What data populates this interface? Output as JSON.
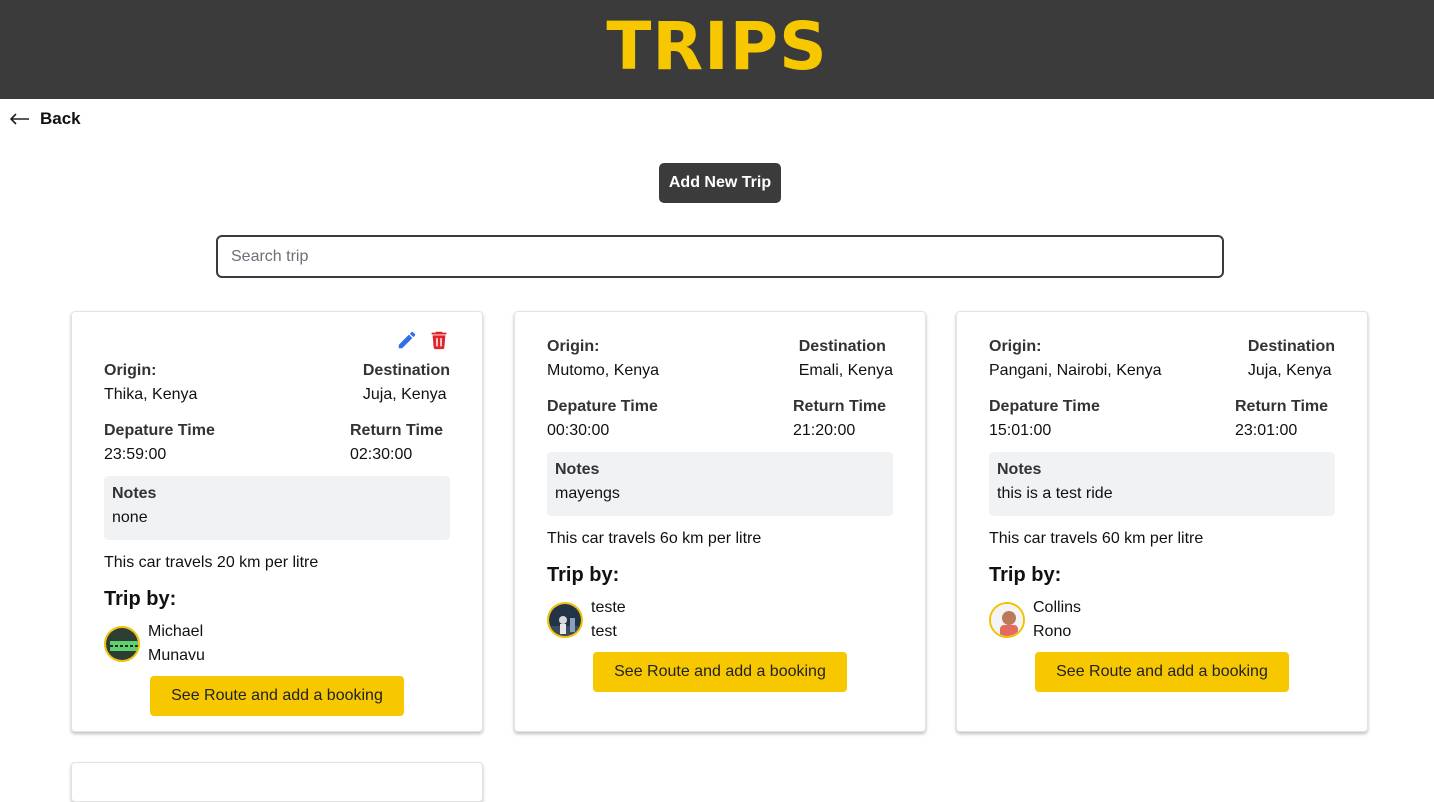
{
  "header": {
    "title": "TRIPS"
  },
  "nav": {
    "back_label": "Back"
  },
  "actions": {
    "add_trip_label": "Add New Trip"
  },
  "search": {
    "placeholder": "Search trip"
  },
  "labels": {
    "origin": "Origin:",
    "destination": "Destination",
    "departure": "Depature Time",
    "return": "Return Time",
    "notes": "Notes",
    "trip_by": "Trip by:",
    "book": "See Route and add a booking"
  },
  "trips": [
    {
      "origin": "Thika, Kenya",
      "destination": "Juja, Kenya",
      "departure": "23:59:00",
      "return": "02:30:00",
      "notes": "none",
      "mileage": "This car travels 20 km per litre",
      "driver_first": "Michael",
      "driver_last": "Munavu"
    },
    {
      "origin": "Mutomo, Kenya",
      "destination": "Emali, Kenya",
      "departure": "00:30:00",
      "return": "21:20:00",
      "notes": "mayengs",
      "mileage": "This car travels 6o km per litre",
      "driver_first": "teste",
      "driver_last": "test"
    },
    {
      "origin": "Pangani, Nairobi, Kenya",
      "destination": "Juja, Kenya",
      "departure": "15:01:00",
      "return": "23:01:00",
      "notes": "this is a test ride",
      "mileage": "This car travels 60 km per litre",
      "driver_first": "Collins",
      "driver_last": "Rono"
    }
  ],
  "icons": {
    "edit": "pencil-icon",
    "delete": "trash-icon",
    "back": "arrow-left-icon"
  },
  "colors": {
    "header_bg": "#3b3b3b",
    "accent": "#f7c800",
    "edit": "#2f6fe8",
    "delete": "#e0242b"
  }
}
